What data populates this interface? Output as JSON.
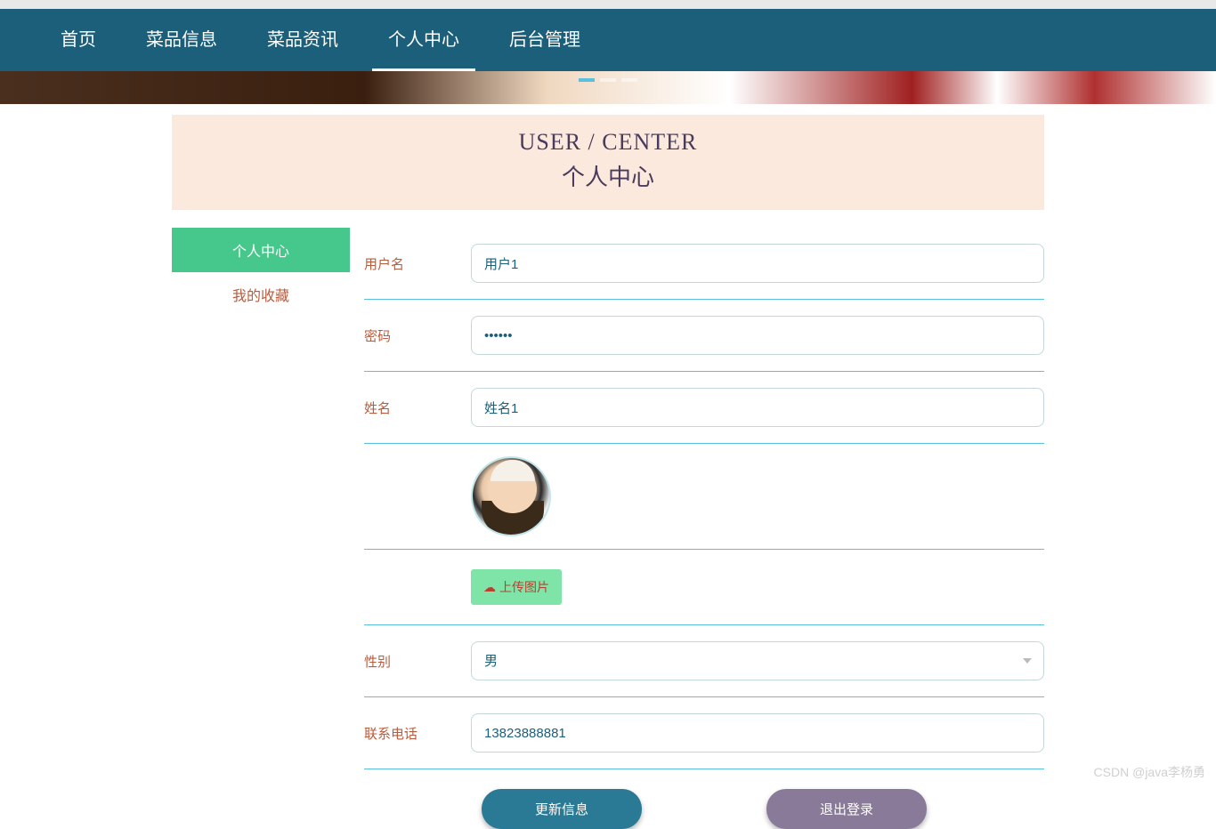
{
  "nav": {
    "items": [
      {
        "label": "首页"
      },
      {
        "label": "菜品信息"
      },
      {
        "label": "菜品资讯"
      },
      {
        "label": "个人中心"
      },
      {
        "label": "后台管理"
      }
    ],
    "activeIndex": 3
  },
  "header": {
    "en": "USER / CENTER",
    "cn": "个人中心"
  },
  "sidebar": {
    "items": [
      {
        "label": "个人中心"
      },
      {
        "label": "我的收藏"
      }
    ],
    "activeIndex": 0
  },
  "form": {
    "username": {
      "label": "用户名",
      "value": "用户1"
    },
    "password": {
      "label": "密码",
      "value": "••••••"
    },
    "name": {
      "label": "姓名",
      "value": "姓名1"
    },
    "upload": {
      "label": "上传图片"
    },
    "gender": {
      "label": "性别",
      "value": "男"
    },
    "phone": {
      "label": "联系电话",
      "value": "13823888881"
    }
  },
  "buttons": {
    "update": "更新信息",
    "logout": "退出登录"
  },
  "watermark": "CSDN @java李杨勇"
}
